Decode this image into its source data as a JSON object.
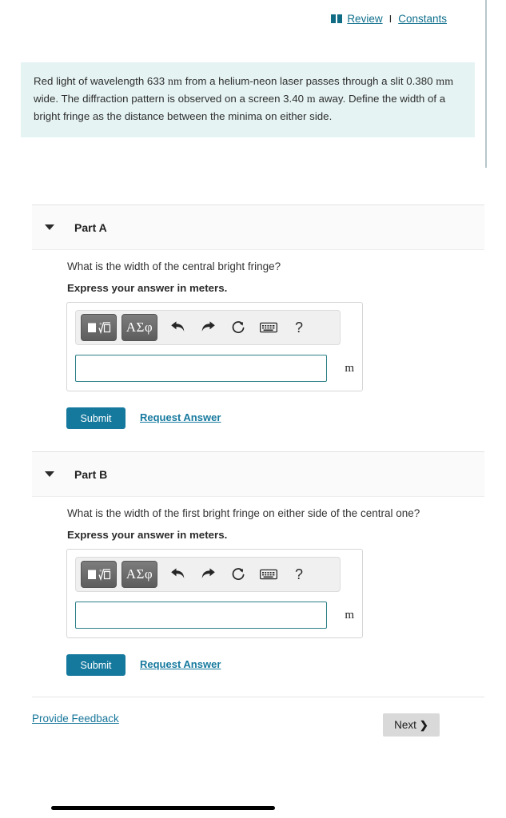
{
  "toplinks": {
    "book_icon": "book-icon",
    "review_label": "Review",
    "separator": "I",
    "constants_label": "Constants"
  },
  "problem": {
    "text_1": "Red light of wavelength 633 ",
    "unit_nm": "nm",
    "text_2": " from a helium-neon laser passes through a slit 0.380 ",
    "unit_mm": "mm",
    "text_3": " wide. The diffraction pattern is observed on a screen 3.40 ",
    "unit_m": "m",
    "text_4": " away. Define the width of a bright fringe as the distance between the minima on either side."
  },
  "math_toolbar": {
    "template_button": "template-icon",
    "greek_button": "ΑΣφ",
    "undo_icon": "undo-arrow",
    "redo_icon": "redo-arrow",
    "reset_icon": "reset-circular-arrow",
    "keyboard_icon": "keyboard",
    "help_label": "?"
  },
  "parts": [
    {
      "id": "a",
      "title": "Part A",
      "question": "What is the width of the central bright fringe?",
      "instruction": "Express your answer in meters.",
      "input_value": "",
      "input_placeholder": "",
      "unit": "m",
      "submit_label": "Submit",
      "request_label": "Request Answer"
    },
    {
      "id": "b",
      "title": "Part B",
      "question": "What is the width of the first bright fringe on either side of the central one?",
      "instruction": "Express your answer in meters.",
      "input_value": "",
      "input_placeholder": "",
      "unit": "m",
      "submit_label": "Submit",
      "request_label": "Request Answer"
    }
  ],
  "footer": {
    "feedback_label": "Provide Feedback",
    "next_label": "Next",
    "next_chevron": "❯"
  },
  "colors": {
    "accent_teal": "#15799e",
    "problem_bg": "#e6f3f3",
    "section_bg": "#fafafa",
    "next_bg": "#d9d9d9",
    "input_border": "#2c7f86"
  }
}
